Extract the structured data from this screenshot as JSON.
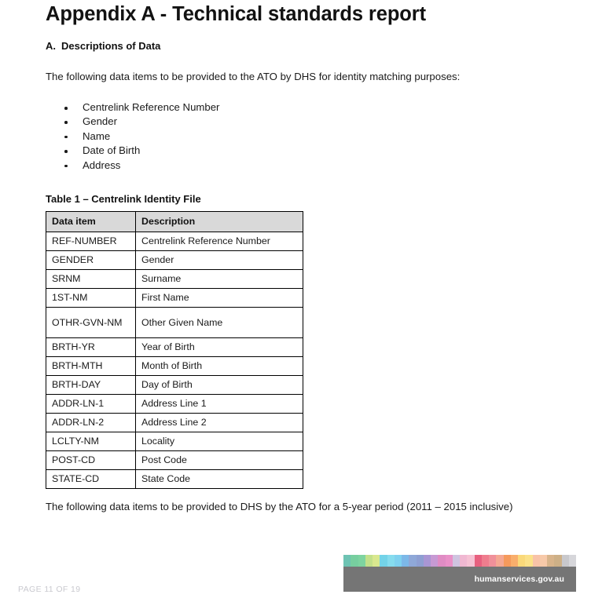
{
  "document": {
    "title": "Appendix A - Technical standards report",
    "section": {
      "letter": "A.",
      "heading": "Descriptions of Data"
    },
    "intro_paragraph": "The following data items to be provided to the ATO by DHS for identity matching purposes:",
    "bullets": [
      "Centrelink Reference Number",
      "Gender",
      "Name",
      "Date of Birth",
      "Address"
    ],
    "table_caption": "Table 1 – Centrelink Identity File",
    "table": {
      "headers": [
        "Data item",
        "Description"
      ],
      "rows": [
        {
          "item": "REF-NUMBER",
          "description": "Centrelink Reference Number"
        },
        {
          "item": "GENDER",
          "description": "Gender"
        },
        {
          "item": "SRNM",
          "description": "Surname"
        },
        {
          "item": "1ST-NM",
          "description": "First Name"
        },
        {
          "item": "OTHR-GVN-NM",
          "description": "Other Given Name"
        },
        {
          "item": "BRTH-YR",
          "description": "Year of Birth"
        },
        {
          "item": "BRTH-MTH",
          "description": "Month of Birth"
        },
        {
          "item": "BRTH-DAY",
          "description": "Day of Birth"
        },
        {
          "item": "ADDR-LN-1",
          "description": "Address Line 1"
        },
        {
          "item": "ADDR-LN-2",
          "description": "Address Line 2"
        },
        {
          "item": "LCLTY-NM",
          "description": "Locality"
        },
        {
          "item": "POST-CD",
          "description": "Post Code"
        },
        {
          "item": "STATE-CD",
          "description": "State Code"
        }
      ]
    },
    "closing_paragraph": "The following data items to be provided to DHS by the ATO for a 5-year period (2011 – 2015 inclusive)"
  },
  "footer": {
    "page_label": "PAGE 11 OF 19",
    "brand_url": "humanservices.gov.au",
    "brand_bar_color": "#757575",
    "page_label_color": "#c9c9cf",
    "swatch_colors": [
      "#6ec3b3",
      "#77cf9f",
      "#7ed4a0",
      "#c3e08a",
      "#d9e88f",
      "#73d3e8",
      "#86dcee",
      "#7fd1ef",
      "#7cb8e8",
      "#8fa8d8",
      "#8e9fd2",
      "#a996d4",
      "#c79ad4",
      "#e08cc4",
      "#e991c8",
      "#cfc4e0",
      "#f0b8d2",
      "#f6c2d4",
      "#e8607f",
      "#ef7d8e",
      "#f0909a",
      "#f4a893",
      "#f59a5c",
      "#f9ae6c",
      "#fad97a",
      "#fbe189",
      "#f8c3a8",
      "#f7c9a9",
      "#d8b48b",
      "#cdb087",
      "#c8c8cc",
      "#d6d6da"
    ]
  }
}
